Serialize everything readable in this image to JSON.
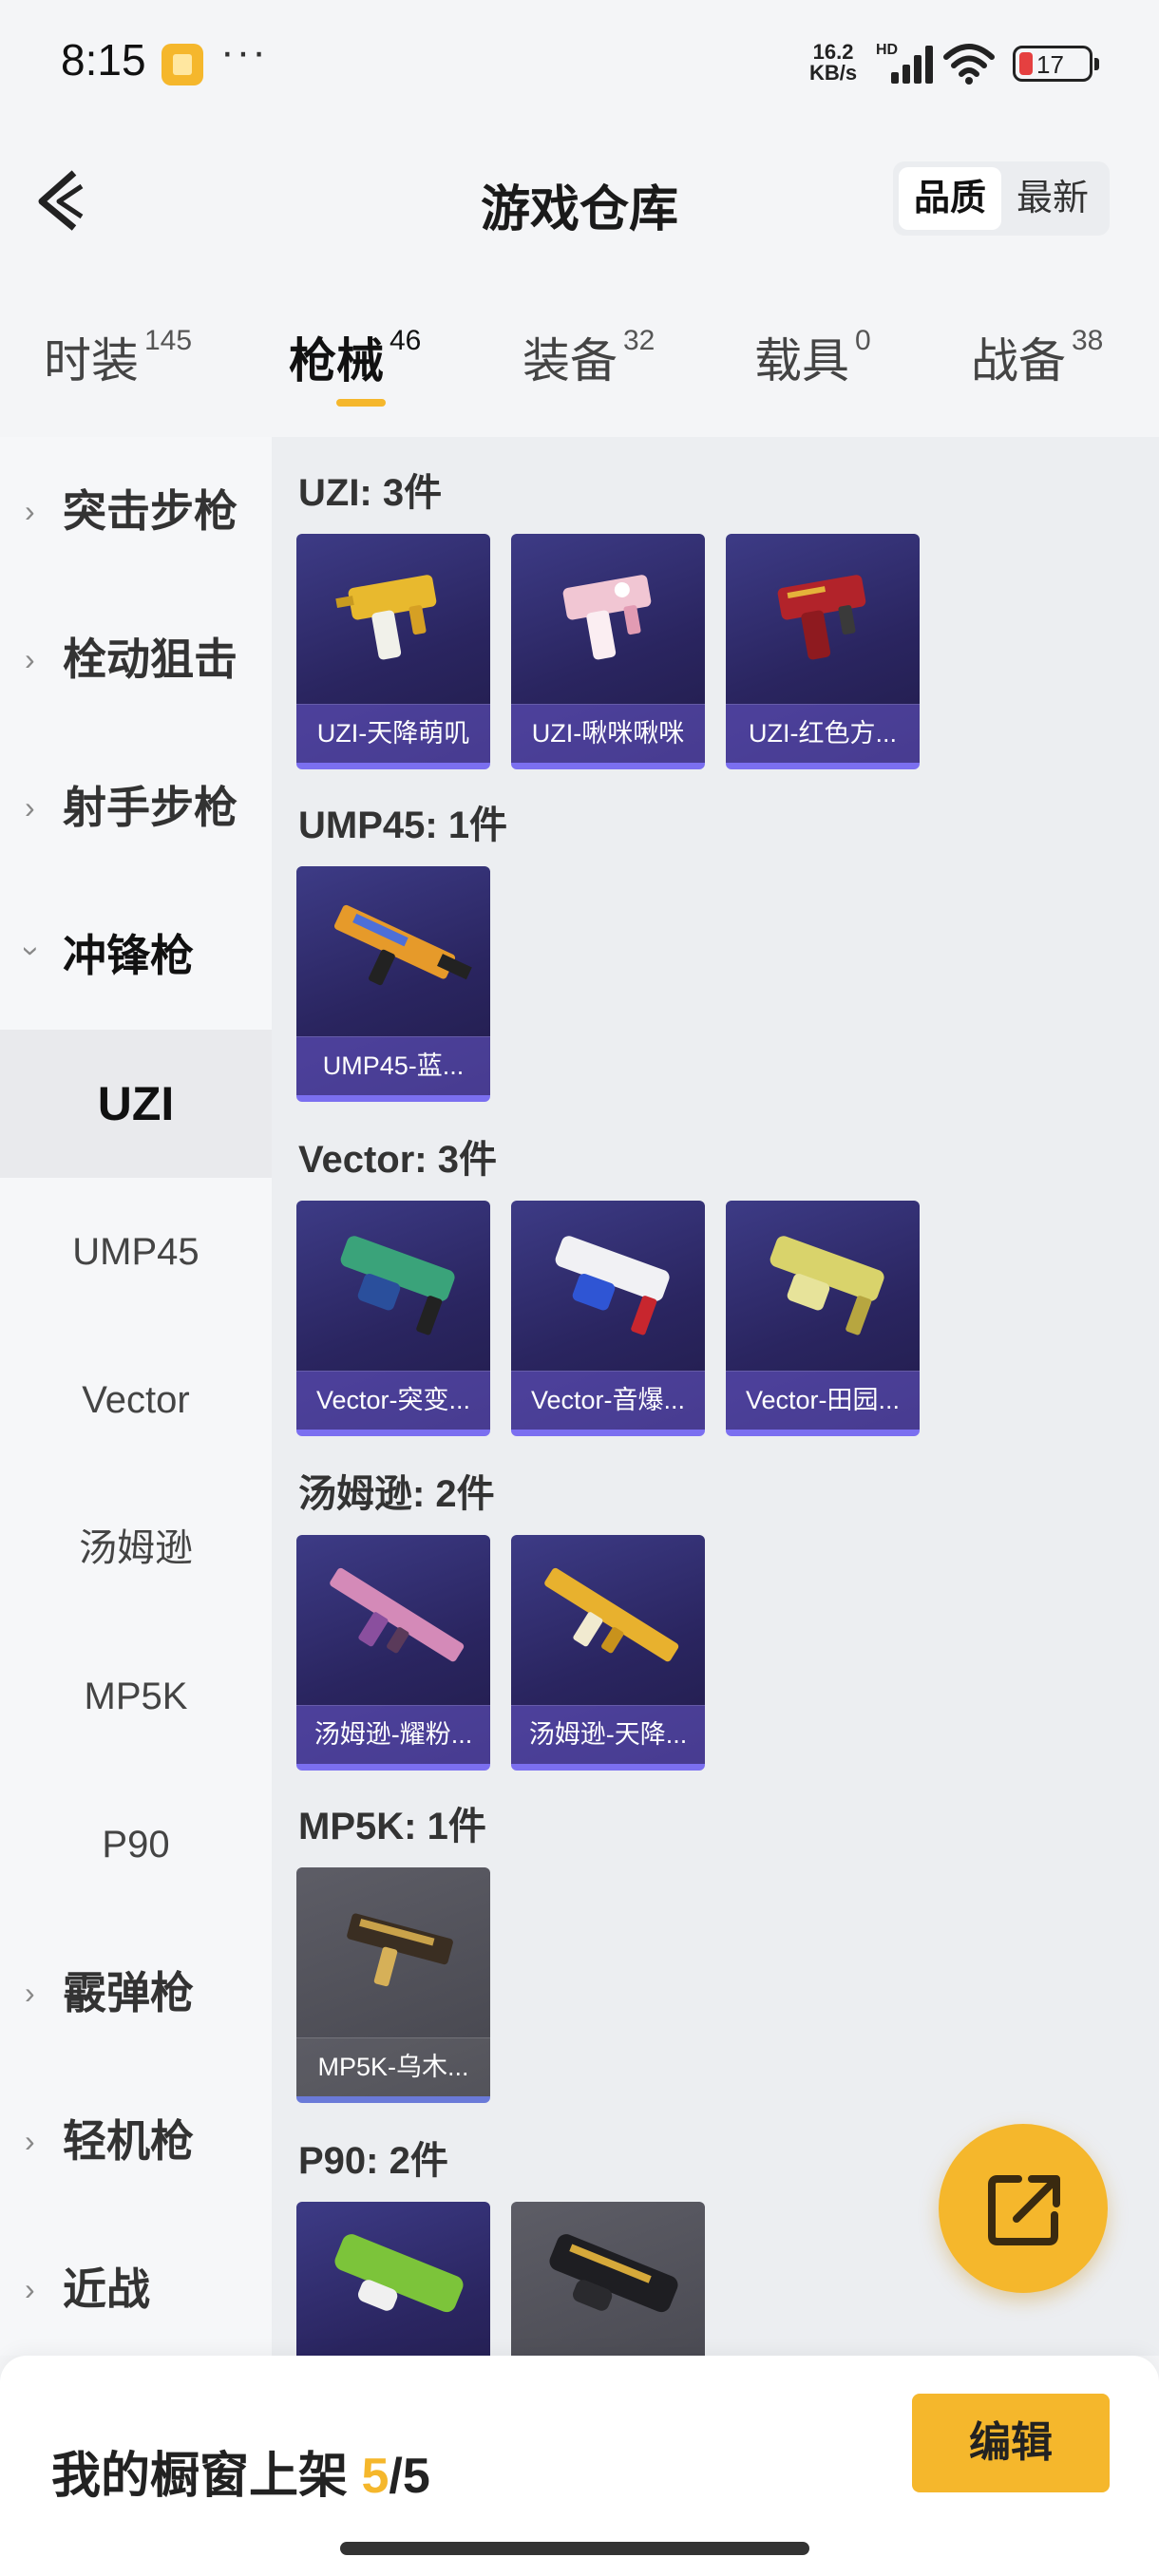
{
  "status_bar": {
    "time": "8:15",
    "dots": "···",
    "net_speed_top": "16.2",
    "net_speed_unit": "KB/s",
    "hd": "HD",
    "battery": "17"
  },
  "header": {
    "title": "游戏仓库",
    "sort_options": [
      "品质",
      "最新"
    ]
  },
  "tabs": [
    {
      "label": "时装",
      "count": "145"
    },
    {
      "label": "枪械",
      "count": "46"
    },
    {
      "label": "装备",
      "count": "32"
    },
    {
      "label": "载具",
      "count": "0"
    },
    {
      "label": "战备",
      "count": "38"
    }
  ],
  "sidebar": {
    "categories": [
      "突击步枪",
      "栓动狙击",
      "射手步枪",
      "冲锋枪",
      "霰弹枪",
      "轻机枪",
      "近战"
    ],
    "subitems": [
      "UZI",
      "UMP45",
      "Vector",
      "汤姆逊",
      "MP5K",
      "P90"
    ]
  },
  "groups": [
    {
      "title": "UZI: 3件",
      "items": [
        "UZI-天降萌叽",
        "UZI-啾咪啾咪",
        "UZI-红色方..."
      ]
    },
    {
      "title": "UMP45: 1件",
      "items": [
        "UMP45-蓝..."
      ]
    },
    {
      "title": "Vector: 3件",
      "items": [
        "Vector-突变...",
        "Vector-音爆...",
        "Vector-田园..."
      ]
    },
    {
      "title": "汤姆逊: 2件",
      "items": [
        "汤姆逊-耀粉...",
        "汤姆逊-天降..."
      ]
    },
    {
      "title": "MP5K: 1件",
      "items": [
        "MP5K-乌木..."
      ]
    },
    {
      "title": "P90: 2件",
      "items": []
    }
  ],
  "bottom": {
    "showcase_label": "我的橱窗上架",
    "current": "5",
    "separator": "/",
    "total": "5",
    "edit_label": "编辑"
  },
  "colors": {
    "accent": "#f5b72c",
    "card_purple": "#2a2560",
    "card_grey": "#4d4d55"
  },
  "icons": [
    "back-arrow-icon",
    "share-icon",
    "wifi-icon",
    "signal-icon",
    "battery-icon",
    "chevron-right-icon",
    "chevron-down-icon"
  ]
}
